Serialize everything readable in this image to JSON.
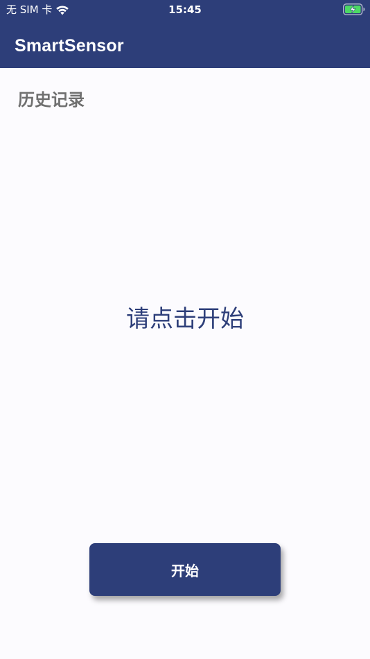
{
  "status_bar": {
    "carrier": "无 SIM 卡",
    "time": "15:45",
    "wifi_icon": "wifi-icon",
    "battery_icon": "battery-charging-icon"
  },
  "app_bar": {
    "title": "SmartSensor"
  },
  "main": {
    "history_label": "历史记录",
    "prompt": "请点击开始",
    "start_button_label": "开始"
  },
  "colors": {
    "primary": "#2d3e79",
    "background": "#fcfbfe",
    "secondary_text": "#6f6f6f",
    "battery_green": "#4cd964"
  }
}
